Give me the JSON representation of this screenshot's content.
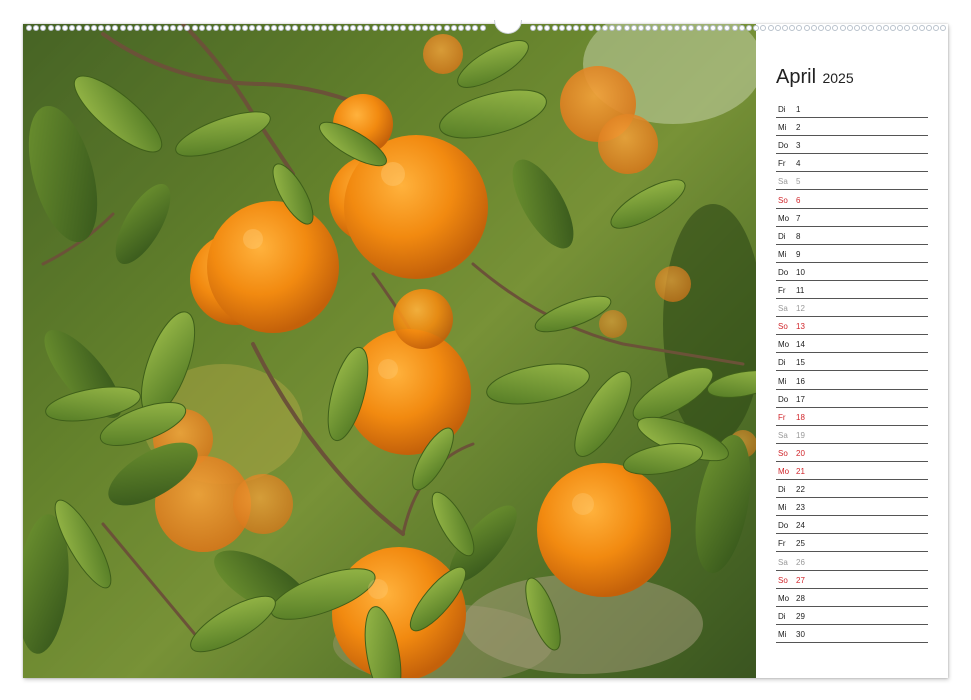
{
  "calendar": {
    "month": "April",
    "year": "2025",
    "days": [
      {
        "wd": "Di",
        "d": "1",
        "type": "normal"
      },
      {
        "wd": "Mi",
        "d": "2",
        "type": "normal"
      },
      {
        "wd": "Do",
        "d": "3",
        "type": "normal"
      },
      {
        "wd": "Fr",
        "d": "4",
        "type": "normal"
      },
      {
        "wd": "Sa",
        "d": "5",
        "type": "sat"
      },
      {
        "wd": "So",
        "d": "6",
        "type": "sun"
      },
      {
        "wd": "Mo",
        "d": "7",
        "type": "normal"
      },
      {
        "wd": "Di",
        "d": "8",
        "type": "normal"
      },
      {
        "wd": "Mi",
        "d": "9",
        "type": "normal"
      },
      {
        "wd": "Do",
        "d": "10",
        "type": "normal"
      },
      {
        "wd": "Fr",
        "d": "11",
        "type": "normal"
      },
      {
        "wd": "Sa",
        "d": "12",
        "type": "sat"
      },
      {
        "wd": "So",
        "d": "13",
        "type": "sun"
      },
      {
        "wd": "Mo",
        "d": "14",
        "type": "normal"
      },
      {
        "wd": "Di",
        "d": "15",
        "type": "normal"
      },
      {
        "wd": "Mi",
        "d": "16",
        "type": "normal"
      },
      {
        "wd": "Do",
        "d": "17",
        "type": "normal"
      },
      {
        "wd": "Fr",
        "d": "18",
        "type": "sun"
      },
      {
        "wd": "Sa",
        "d": "19",
        "type": "sat"
      },
      {
        "wd": "So",
        "d": "20",
        "type": "sun"
      },
      {
        "wd": "Mo",
        "d": "21",
        "type": "sun"
      },
      {
        "wd": "Di",
        "d": "22",
        "type": "normal"
      },
      {
        "wd": "Mi",
        "d": "23",
        "type": "normal"
      },
      {
        "wd": "Do",
        "d": "24",
        "type": "normal"
      },
      {
        "wd": "Fr",
        "d": "25",
        "type": "normal"
      },
      {
        "wd": "Sa",
        "d": "26",
        "type": "sat"
      },
      {
        "wd": "So",
        "d": "27",
        "type": "sun"
      },
      {
        "wd": "Mo",
        "d": "28",
        "type": "normal"
      },
      {
        "wd": "Di",
        "d": "29",
        "type": "normal"
      },
      {
        "wd": "Mi",
        "d": "30",
        "type": "normal"
      }
    ]
  },
  "colors": {
    "holiday": "#d0262b",
    "saturday": "#999999",
    "weekday": "#222222",
    "orange_fruit": "#f28a10",
    "leaf": "#5f8a2a"
  }
}
